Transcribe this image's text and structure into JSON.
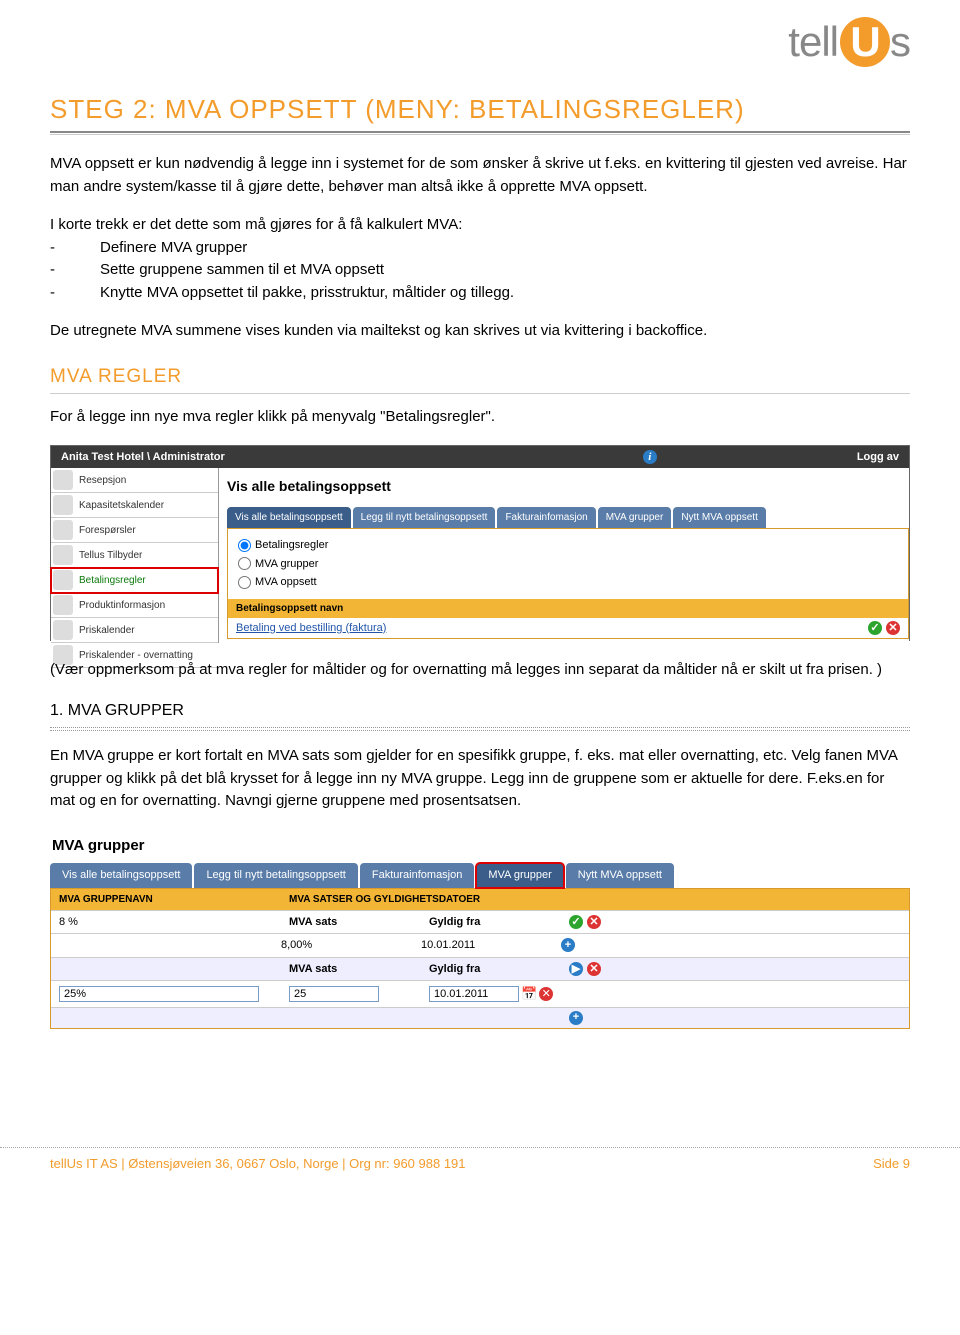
{
  "logo": {
    "text": "tell",
    "letter": "U",
    "suffix": "s"
  },
  "h1": "STEG 2: MVA OPPSETT (MENY: BETALINGSREGLER)",
  "intro": "MVA oppsett er kun nødvendig å legge inn i systemet for de som ønsker å skrive ut f.eks. en kvittering til gjesten ved avreise. Har man andre system/kasse til å gjøre dette, behøver man altså ikke å opprette MVA oppsett.",
  "stepsLead": "I korte trekk er det dette som må gjøres for å få kalkulert MVA:",
  "steps": [
    "Definere MVA grupper",
    "Sette gruppene sammen til et MVA oppsett",
    "Knytte MVA oppsettet til pakke, prisstruktur, måltider og tillegg."
  ],
  "p2": "De utregnete MVA summene vises kunden via mailtekst og kan skrives ut via kvittering i backoffice.",
  "h2": "MVA REGLER",
  "p3": "For å legge inn nye mva regler klikk på menyvalg \"Betalingsregler\".",
  "shot1": {
    "breadcrumb": "Anita Test Hotel \\ Administrator",
    "loggav": "Logg av",
    "sidebar": [
      "Resepsjon",
      "Kapasitetskalender",
      "Forespørsler",
      "Tellus Tilbyder",
      "Betalingsregler",
      "Produktinformasjon",
      "Priskalender",
      "Priskalender - overnatting"
    ],
    "mainTitle": "Vis alle betalingsoppsett",
    "tabs": [
      "Vis alle betalingsoppsett",
      "Legg til nytt betalingsoppsett",
      "Fakturainfomasjon",
      "MVA grupper",
      "Nytt MVA oppsett"
    ],
    "radios": [
      "Betalingsregler",
      "MVA grupper",
      "MVA oppsett"
    ],
    "yheader": "Betalingsoppsett navn",
    "link": "Betaling ved bestilling (faktura)"
  },
  "p4": "(Vær oppmerksom på at mva regler for måltider og for overnatting må legges inn separat da måltider nå er skilt ut fra prisen. )",
  "h3": "1. MVA GRUPPER",
  "p5": "En MVA gruppe er kort fortalt en MVA sats som gjelder for en spesifikk gruppe, f. eks. mat eller overnatting, etc. Velg fanen MVA grupper og klikk på det blå krysset for å legge inn ny MVA gruppe. Legg inn de gruppene som er aktuelle for dere. F.eks.en for mat og en for overnatting. Navngi gjerne gruppene med prosentsatsen.",
  "shot2": {
    "title": "MVA grupper",
    "tabs": [
      "Vis alle betalingsoppsett",
      "Legg til nytt betalingsoppsett",
      "Fakturainfomasjon",
      "MVA grupper",
      "Nytt MVA oppsett"
    ],
    "h": [
      "MVA GRUPPENAVN",
      "MVA SATSER OG GYLDIGHETSDATOER"
    ],
    "labels": {
      "sats": "MVA sats",
      "fra": "Gyldig fra"
    },
    "rows": [
      {
        "name": "8 %",
        "sats": "8,00%",
        "fra": "10.01.2011"
      },
      {
        "name": "25%",
        "sats": "25",
        "fra": "10.01.2011",
        "editable": true
      }
    ]
  },
  "footer": {
    "left": "tellUs IT AS | Østensjøveien 36, 0667 Oslo, Norge | Org nr: 960 988 191",
    "right": "Side 9"
  }
}
